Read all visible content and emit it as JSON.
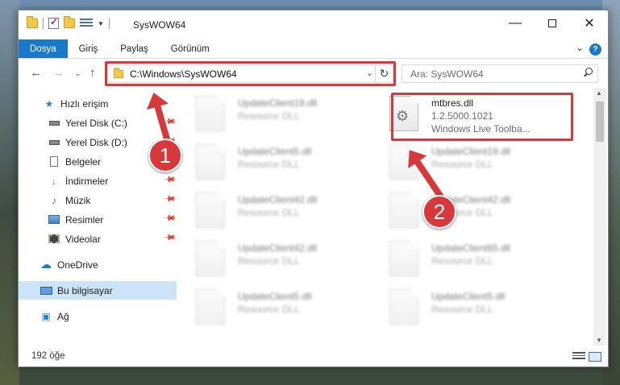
{
  "window": {
    "title": "SysWOW64",
    "minimize_icon": "minimize-icon",
    "maximize_icon": "maximize-icon",
    "close_icon": "close-icon"
  },
  "ribbon": {
    "tabs": [
      "Dosya",
      "Giriş",
      "Paylaş",
      "Görünüm"
    ],
    "active_tab": "Dosya",
    "help": "?"
  },
  "address": {
    "path": "C:\\Windows\\SysWOW64",
    "search_placeholder": "Ara: SysWOW64"
  },
  "sidebar": {
    "items": [
      {
        "label": "Hızlı erişim",
        "icon": "star-icon"
      },
      {
        "label": "Yerel Disk (C:)",
        "icon": "drive-icon",
        "pinned": true
      },
      {
        "label": "Yerel Disk (D:)",
        "icon": "drive-icon",
        "pinned": true
      },
      {
        "label": "Belgeler",
        "icon": "document-icon",
        "pinned": true
      },
      {
        "label": "İndirmeler",
        "icon": "download-icon",
        "pinned": true
      },
      {
        "label": "Müzik",
        "icon": "music-icon",
        "pinned": true
      },
      {
        "label": "Resimler",
        "icon": "picture-icon",
        "pinned": true
      },
      {
        "label": "Videolar",
        "icon": "video-icon",
        "pinned": true
      },
      {
        "label": "OneDrive",
        "icon": "cloud-icon"
      },
      {
        "label": "Bu bilgisayar",
        "icon": "computer-icon",
        "selected": true
      },
      {
        "label": "Ağ",
        "icon": "network-icon"
      }
    ]
  },
  "files": [
    {
      "name": "UpdateClient19.dll",
      "desc": "Resource DLL"
    },
    {
      "name": "mtbres.dll",
      "version": "1.2.5000.1021",
      "desc": "Windows Live Toolba..."
    },
    {
      "name": "UpdateClient5.dll",
      "desc": "Resource DLL"
    },
    {
      "name": "UpdateClient19.dll",
      "desc": "Resource DLL"
    },
    {
      "name": "UpdateClient42.dll",
      "desc": "Resource DLL"
    },
    {
      "name": "UpdateClient42.dll",
      "desc": "Resource DLL"
    },
    {
      "name": "UpdateClient42.dll",
      "desc": "Resource DLL"
    },
    {
      "name": "UpdateClient65.dll",
      "desc": "Resource DLL"
    },
    {
      "name": "UpdateClient5.dll",
      "desc": "Resource DLL"
    },
    {
      "name": "UpdateClient5.dll",
      "desc": "Resource DLL"
    }
  ],
  "status": {
    "count": "192 öğe"
  },
  "annotations": {
    "step1": "1",
    "step2": "2",
    "highlight_color": "#d7393b"
  },
  "colors": {
    "accent": "#1979ca",
    "selected_bg": "#cce4f7"
  }
}
